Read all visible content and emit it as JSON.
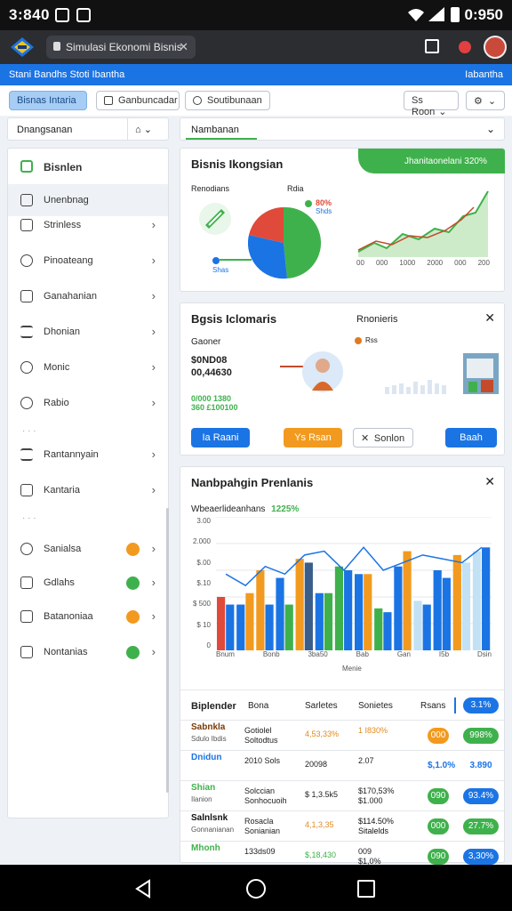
{
  "status": {
    "time_left": "3:840",
    "time_right": "0:950"
  },
  "browser": {
    "tab_title": "Simulasi Ekonomi Bisnis"
  },
  "bluebar": {
    "left": "Stani  Bandhs  Stoti  Ibantha",
    "right": "Iabantha"
  },
  "toolbar": {
    "b1": "Bisnas Intaria",
    "b2": "Ganbuncadar",
    "b3": "Soutibunaan",
    "r1": "Ss Roon"
  },
  "subbar": {
    "left": "Dnangsanan",
    "right": "Nambanan"
  },
  "sidebar": {
    "header": "Bisnlen",
    "items": [
      "Unenbnag",
      "Strinless",
      "Pinoateang",
      "Ganahanian",
      "Dhonian",
      "Monic",
      "Rabio",
      "Rantannyain",
      "Kantaria",
      "Sanialsa",
      "Gdlahs",
      "Batanoniaa",
      "Nontanias"
    ],
    "badge_colors": [
      "#f29a1f",
      "#3fb14c",
      "#f29a1f",
      "#3fb14c"
    ]
  },
  "card1": {
    "title": "Bisnis Ikongsian",
    "banner": "Jhanitaonelani 320%",
    "sub_left": "Renodians",
    "sub_mid": "Rdia",
    "pie_label1": "80%",
    "pie_label2": "Shds",
    "pie_label3": "Shas",
    "line_ticks": [
      "00",
      "000",
      "1000",
      "2000",
      "000",
      "200"
    ]
  },
  "card2": {
    "title": "Bgsis Iclomaris",
    "right_title": "Rnonieris",
    "label": "Gaoner",
    "big_value1": "$0ND08",
    "big_value2": "00,44630",
    "green_text": "0/000 1380\n360 £100100",
    "legend": "Rss",
    "btn1": "Ia Raani",
    "btn2": "Ys Rsan",
    "btn3": "Sonlon",
    "btn4": "Baah"
  },
  "card3": {
    "title": "Nanbpahgin Prenlanis",
    "subtitle": "Wbeaerlideanhans",
    "subtitle_pct": "1225%",
    "x_axis_title": "Menie",
    "y_ticks": [
      "3.00",
      "2.000",
      "$.00",
      "$.10",
      "$ 500",
      "$ 10",
      "0"
    ],
    "x_ticks": [
      "Bnum",
      "Bonb",
      "3ba50",
      "Bab",
      "Gan",
      "I5b",
      "Dsin"
    ]
  },
  "chart_data": {
    "type": "bar",
    "categories": [
      "Bnum",
      "Bonb",
      "3ba50",
      "Bab",
      "Gan",
      "I5b",
      "Dsin"
    ],
    "series": [
      {
        "values": [
          1.4,
          1.2,
          2.1,
          1.9,
          2.4,
          1.5,
          2.2,
          2.0,
          1.1,
          2.2,
          1.3,
          2.1,
          2.5,
          2.6
        ]
      },
      {
        "values": [
          1.2,
          1.5,
          1.2,
          1.2,
          2.3,
          1.5,
          2.1,
          2.0,
          1.0,
          2.6,
          1.2,
          1.9,
          2.3,
          2.7
        ]
      },
      {
        "values": [
          2.0,
          1.7,
          2.2,
          2.0,
          2.5,
          2.6,
          2.1,
          2.7,
          2.1,
          2.3,
          2.5,
          2.4,
          2.3,
          2.7
        ]
      }
    ],
    "ylim": [
      0,
      3.5
    ],
    "grid": true
  },
  "table": {
    "headers": [
      "Biplender",
      "Bona",
      "Sarletes",
      "Sonietes",
      "Rsans",
      "3.1%"
    ],
    "rows": [
      {
        "c1": "Sabnkla",
        "c1b": "Sdulo Ibdis",
        "c2": "Gotiolel\nSoltodtus",
        "c3": "4,53,33%",
        "c4": "1 I830%",
        "c5": "000",
        "c6": "998%",
        "c1_color": "#7a3a06",
        "c3_color": "#e08a1f",
        "c4_color": "#e08a1f",
        "p1": "#f29a1f",
        "p2": "#3fb14c"
      },
      {
        "c1": "Dnidun",
        "c1b": "",
        "c2": "2010 Sols",
        "c3": "20098",
        "c4": "2.07",
        "c5": "$,1.0%",
        "c6": "3.890",
        "c1_color": "#1b74e4",
        "c3_color": "#222",
        "c4_color": "#222",
        "p1": "",
        "p2": ""
      },
      {
        "c1": "Shian",
        "c1b": "Ilanion",
        "c2": "Solccian\nSonhocuoih",
        "c3": "$ 1,3.5k5",
        "c4": "$170,53%\n$1.000",
        "c5": "090",
        "c6": "93.4%",
        "c1_color": "#3fb14c",
        "c3_color": "#222",
        "c4_color": "#222",
        "p1": "#3fb14c",
        "p2": "#1b74e4"
      },
      {
        "c1": "Salnlsnk",
        "c1b": "Gonnanianan",
        "c2": "Rosacla\nSonianian",
        "c3": "4,1,3,35",
        "c4": "$114.50%\nSitalelds",
        "c5": "000",
        "c6": "27.7%",
        "c1_color": "#111",
        "c3_color": "#e08a1f",
        "c4_color": "#111",
        "p1": "#3fb14c",
        "p2": "#3fb14c"
      },
      {
        "c1": "Mhonh",
        "c1b": "",
        "c2": "133ds09",
        "c3": "$,18,430",
        "c4": "009\n$1,0%",
        "c5": "090",
        "c6": "3,30%",
        "c1_color": "#3fb14c",
        "c3_color": "#3fb14c",
        "c4_color": "#222",
        "p1": "#3fb14c",
        "p2": "#1b74e4"
      }
    ]
  }
}
